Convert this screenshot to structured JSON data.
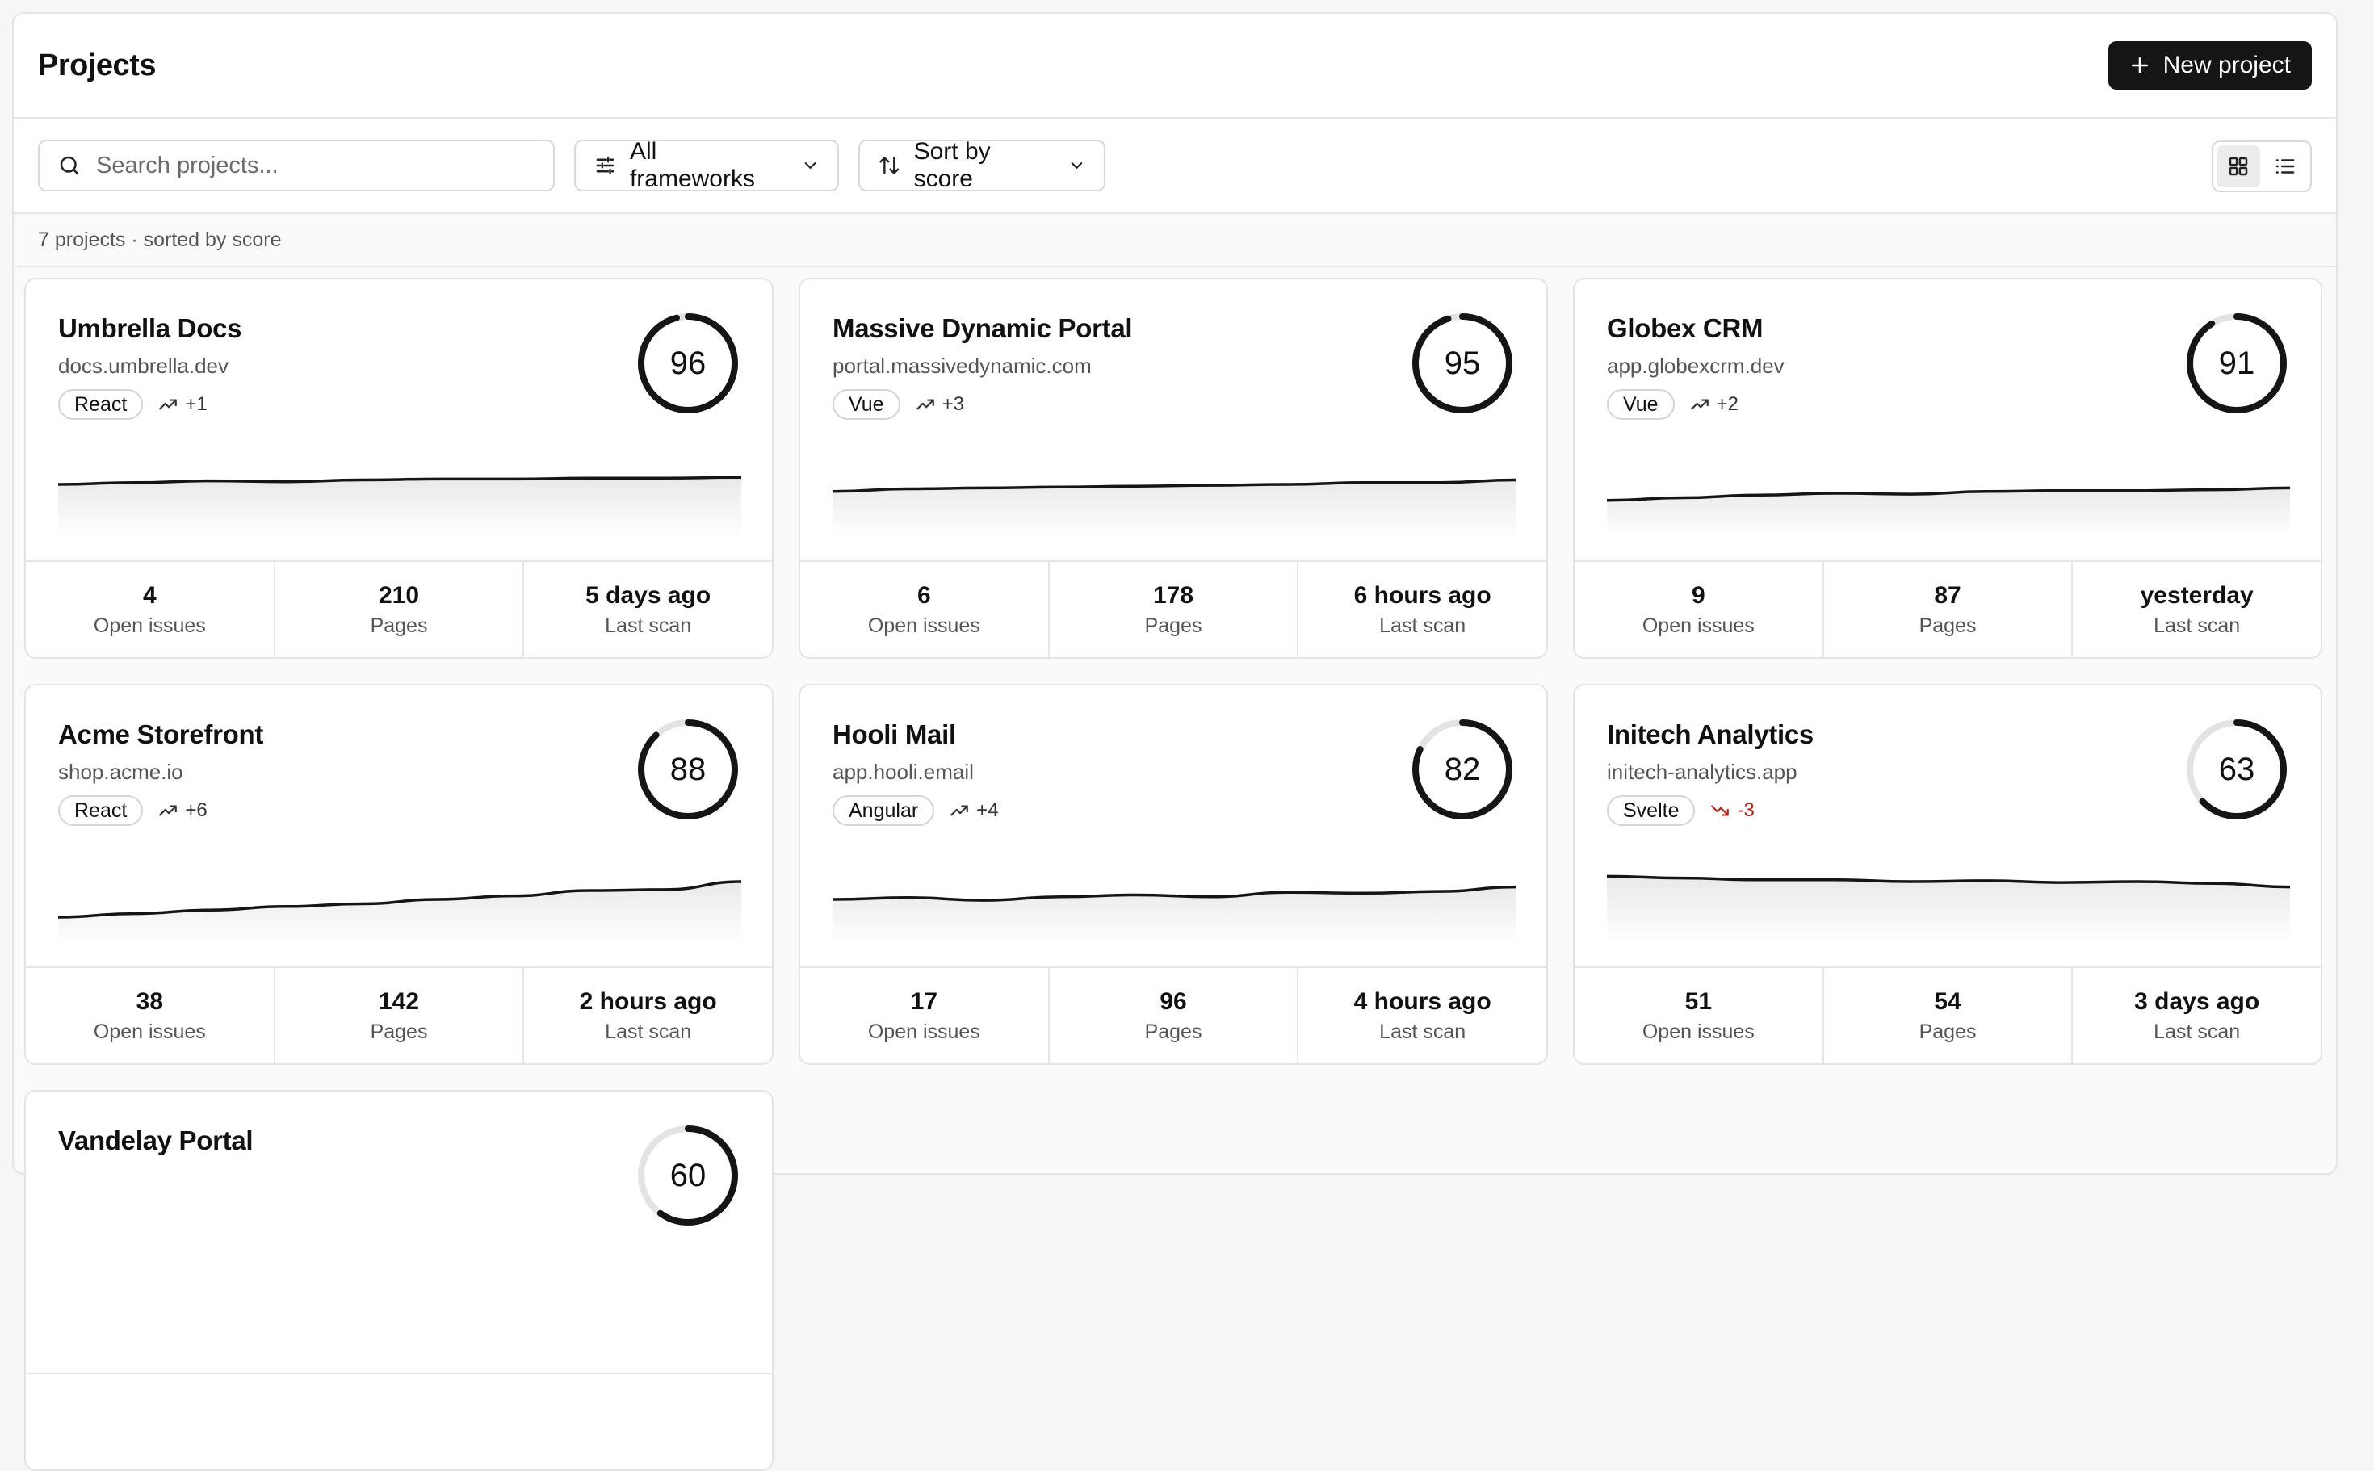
{
  "header": {
    "title": "Projects",
    "new_button": "New project"
  },
  "toolbar": {
    "search_placeholder": "Search projects...",
    "framework_filter": "All frameworks",
    "sort": "Sort by score"
  },
  "summary": "7 projects · sorted by score",
  "colors": {
    "accent": "#151515",
    "negative": "#b42318",
    "ring_track": "#e3e3e3"
  },
  "projects": [
    {
      "name": "Umbrella Docs",
      "domain": "docs.umbrella.dev",
      "framework": "React",
      "trend": "+1",
      "trend_direction": "up",
      "score": 96,
      "history": [
        0.4,
        0.38,
        0.36,
        0.37,
        0.35,
        0.34,
        0.34,
        0.33,
        0.33,
        0.32
      ],
      "stats": [
        {
          "value": "4",
          "label": "Open issues"
        },
        {
          "value": "210",
          "label": "Pages"
        },
        {
          "value": "5 days ago",
          "label": "Last scan"
        }
      ]
    },
    {
      "name": "Massive Dynamic Portal",
      "domain": "portal.massivedynamic.com",
      "framework": "Vue",
      "trend": "+3",
      "trend_direction": "up",
      "score": 95,
      "history": [
        0.48,
        0.45,
        0.44,
        0.43,
        0.42,
        0.41,
        0.4,
        0.38,
        0.38,
        0.35
      ],
      "stats": [
        {
          "value": "6",
          "label": "Open issues"
        },
        {
          "value": "178",
          "label": "Pages"
        },
        {
          "value": "6 hours ago",
          "label": "Last scan"
        }
      ]
    },
    {
      "name": "Globex CRM",
      "domain": "app.globexcrm.dev",
      "framework": "Vue",
      "trend": "+2",
      "trend_direction": "up",
      "score": 91,
      "history": [
        0.58,
        0.55,
        0.52,
        0.5,
        0.51,
        0.48,
        0.47,
        0.47,
        0.46,
        0.44
      ],
      "stats": [
        {
          "value": "9",
          "label": "Open issues"
        },
        {
          "value": "87",
          "label": "Pages"
        },
        {
          "value": "yesterday",
          "label": "Last scan"
        }
      ]
    },
    {
      "name": "Acme Storefront",
      "domain": "shop.acme.io",
      "framework": "React",
      "trend": "+6",
      "trend_direction": "up",
      "score": 88,
      "history": [
        0.7,
        0.66,
        0.62,
        0.58,
        0.55,
        0.5,
        0.46,
        0.4,
        0.39,
        0.3
      ],
      "stats": [
        {
          "value": "38",
          "label": "Open issues"
        },
        {
          "value": "142",
          "label": "Pages"
        },
        {
          "value": "2 hours ago",
          "label": "Last scan"
        }
      ]
    },
    {
      "name": "Hooli Mail",
      "domain": "app.hooli.email",
      "framework": "Angular",
      "trend": "+4",
      "trend_direction": "up",
      "score": 82,
      "history": [
        0.5,
        0.48,
        0.51,
        0.47,
        0.45,
        0.47,
        0.42,
        0.43,
        0.41,
        0.36
      ],
      "stats": [
        {
          "value": "17",
          "label": "Open issues"
        },
        {
          "value": "96",
          "label": "Pages"
        },
        {
          "value": "4 hours ago",
          "label": "Last scan"
        }
      ]
    },
    {
      "name": "Initech Analytics",
      "domain": "initech-analytics.app",
      "framework": "Svelte",
      "trend": "-3",
      "trend_direction": "down",
      "score": 63,
      "history": [
        0.24,
        0.26,
        0.28,
        0.28,
        0.3,
        0.29,
        0.31,
        0.3,
        0.32,
        0.36
      ],
      "stats": [
        {
          "value": "51",
          "label": "Open issues"
        },
        {
          "value": "54",
          "label": "Pages"
        },
        {
          "value": "3 days ago",
          "label": "Last scan"
        }
      ]
    },
    {
      "name": "Vandelay Portal",
      "domain": "",
      "framework": "",
      "trend": "",
      "trend_direction": "up",
      "score": 60,
      "history": [],
      "stats": []
    }
  ]
}
